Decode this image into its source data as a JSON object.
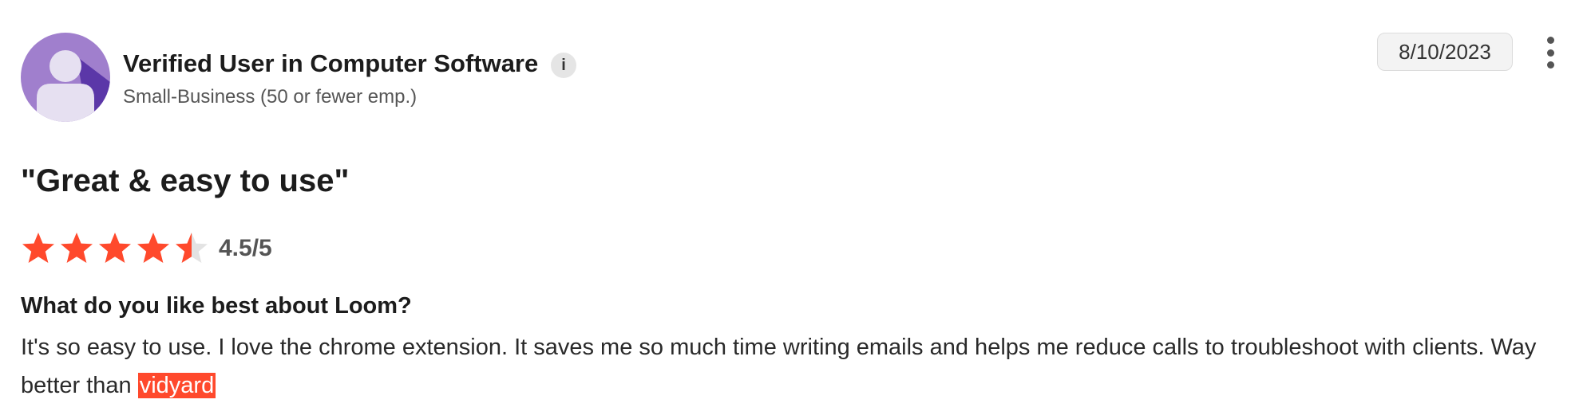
{
  "reviewer": {
    "name": "Verified User in Computer Software",
    "info_icon": "info-icon",
    "info_glyph": "i",
    "segment": "Small-Business (50 or fewer emp.)"
  },
  "date": "8/10/2023",
  "more_icon": "more-vertical-icon",
  "review": {
    "title": "\"Great & easy to use\"",
    "rating": 4.5,
    "rating_max": 5,
    "rating_text": "4.5/5",
    "question": "What do you like best about Loom?",
    "answer_text": "It's so easy to use. I love the chrome extension. It saves me so much time writing emails and helps me reduce calls to troubleshoot with clients. Way better than ",
    "answer_highlight": "vidyard"
  },
  "colors": {
    "star_fill": "#ff492c",
    "star_empty": "#e3e3e3",
    "avatar_bg": "#a07fcd",
    "avatar_shadow": "#5b37a8",
    "avatar_figure": "#e6e0f1",
    "highlight_bg": "#ff492c"
  }
}
